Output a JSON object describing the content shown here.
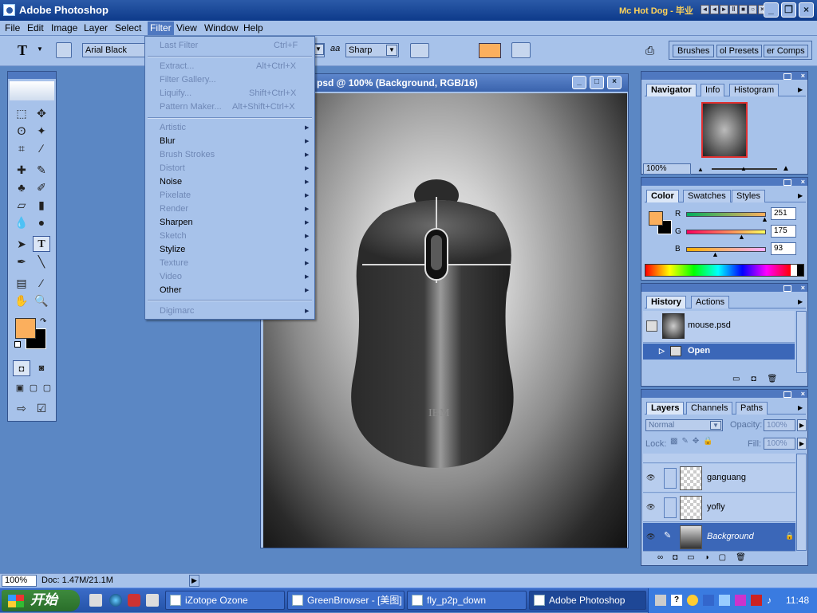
{
  "app": {
    "title": "Adobe Photoshop",
    "now_playing": "Mc Hot Dog - 毕业"
  },
  "menubar": [
    "File",
    "Edit",
    "Image",
    "Layer",
    "Select",
    "Filter",
    "View",
    "Window",
    "Help"
  ],
  "options": {
    "font_family": "Arial Black",
    "antialias_label": "aa",
    "antialias": "Sharp",
    "palettes": [
      "Brushes",
      "ol Presets",
      "er Comps"
    ]
  },
  "filter_menu": {
    "last_filter": {
      "label": "Last Filter",
      "shortcut": "Ctrl+F"
    },
    "group1": [
      {
        "label": "Extract...",
        "shortcut": "Alt+Ctrl+X"
      },
      {
        "label": "Filter Gallery...",
        "shortcut": ""
      },
      {
        "label": "Liquify...",
        "shortcut": "Shift+Ctrl+X"
      },
      {
        "label": "Pattern Maker...",
        "shortcut": "Alt+Shift+Ctrl+X"
      }
    ],
    "group2": [
      {
        "label": "Artistic",
        "enabled": false
      },
      {
        "label": "Blur",
        "enabled": true
      },
      {
        "label": "Brush Strokes",
        "enabled": false
      },
      {
        "label": "Distort",
        "enabled": false
      },
      {
        "label": "Noise",
        "enabled": true
      },
      {
        "label": "Pixelate",
        "enabled": false
      },
      {
        "label": "Render",
        "enabled": false
      },
      {
        "label": "Sharpen",
        "enabled": true
      },
      {
        "label": "Sketch",
        "enabled": false
      },
      {
        "label": "Stylize",
        "enabled": true
      },
      {
        "label": "Texture",
        "enabled": false
      },
      {
        "label": "Video",
        "enabled": false
      },
      {
        "label": "Other",
        "enabled": true
      }
    ],
    "digimarc": {
      "label": "Digimarc"
    }
  },
  "document": {
    "title": "psd @ 100% (Background, RGB/16)",
    "brand": "IBM"
  },
  "navigator": {
    "tabs": [
      "Navigator",
      "Info",
      "Histogram"
    ],
    "zoom": "100%"
  },
  "color": {
    "tabs": [
      "Color",
      "Swatches",
      "Styles"
    ],
    "r_label": "R",
    "g_label": "G",
    "b_label": "B",
    "r": "251",
    "g": "175",
    "b": "93",
    "r_frac": 0.98,
    "g_frac": 0.69,
    "b_frac": 0.36,
    "fg": "#fbaf5d",
    "bg": "#000000"
  },
  "history": {
    "tabs": [
      "History",
      "Actions"
    ],
    "snapshot": "mouse.psd",
    "step": "Open"
  },
  "layers": {
    "tabs": [
      "Layers",
      "Channels",
      "Paths"
    ],
    "blend": "Normal",
    "opacity_label": "Opacity:",
    "opacity": "100%",
    "lock_label": "Lock:",
    "fill_label": "Fill:",
    "fill": "100%",
    "items": [
      "ganguang",
      "yofly",
      "Background"
    ]
  },
  "status": {
    "zoom": "100%",
    "doc": "Doc: 1.47M/21.1M"
  },
  "taskbar": {
    "start": "开始",
    "tasks": [
      "iZotope Ozone",
      "GreenBrowser - [美图]",
      "fly_p2p_down",
      "Adobe Photoshop"
    ],
    "clock": "11:48"
  }
}
